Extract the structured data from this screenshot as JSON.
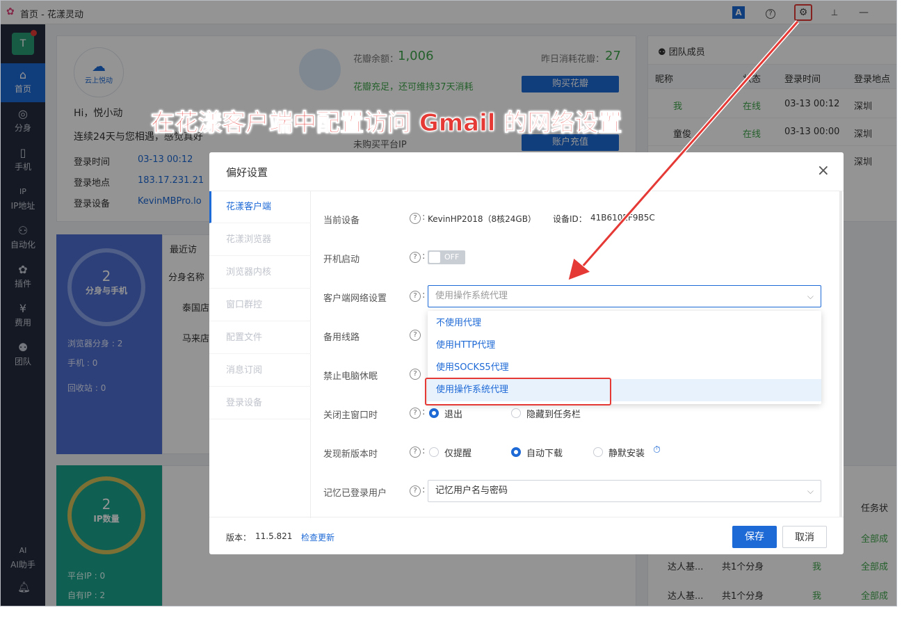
{
  "window": {
    "title": "首页 - 花漾灵动"
  },
  "topbar": {
    "translate_icon": "A",
    "help_icon": "?",
    "settings_icon": "⚙",
    "pin_icon": "📌",
    "minimize": "—"
  },
  "sidebar": {
    "avatar": "T",
    "items": [
      {
        "label": "首页",
        "icon": "⌂"
      },
      {
        "label": "分身",
        "icon": "◎"
      },
      {
        "label": "手机",
        "icon": "▯"
      },
      {
        "label": "IP地址",
        "icon": "IP"
      },
      {
        "label": "自动化",
        "icon": "⚇"
      },
      {
        "label": "插件",
        "icon": "✿"
      },
      {
        "label": "费用",
        "icon": "¥"
      },
      {
        "label": "团队",
        "icon": "⚉"
      },
      {
        "label": "AI助手",
        "icon": "AI"
      }
    ]
  },
  "profile": {
    "logo_text": "云上悦动",
    "greeting": "Hi，悦小动",
    "days": "连续24天与您相遇，感觉真好",
    "login_time_label": "登录时间",
    "login_time": "03-13 00:12",
    "login_place_label": "登录地点",
    "login_place": "183.17.231.21",
    "login_device_label": "登录设备",
    "login_device": "KevinMBPro.lo"
  },
  "petals": {
    "balance_label": "花瓣余额：",
    "balance": "1,006",
    "yesterday_label": "昨日消耗花瓣：",
    "yesterday": "27",
    "status": "花瓣充足，还可维持37天消耗",
    "buy_btn": "购买花瓣",
    "platform_ip": "未购买平台IP",
    "recharge_btn": "账户充值"
  },
  "team": {
    "title": "团队成员",
    "cols": [
      "昵称",
      "状态",
      "登录时间",
      "登录地点"
    ],
    "rows": [
      {
        "name": "我",
        "status": "在线",
        "time": "03-13 00:12",
        "place": "深圳"
      },
      {
        "name": "童俊",
        "status": "在线",
        "time": "03-13 00:00",
        "place": "深圳"
      },
      {
        "name": "",
        "status": "",
        "time": "",
        "place": "深圳"
      }
    ]
  },
  "stats": {
    "ring1_num": "2",
    "ring1_label": "分身与手机",
    "browser_label": "浏览器分身",
    "browser_val": ": 2",
    "phone_label": "手机",
    "phone_val": ": 0",
    "recycle_label": "回收站",
    "recycle_val": ": 0",
    "ring2_num": "2",
    "ring2_label": "IP数量",
    "platform_ip_label": "平台IP",
    "platform_ip_val": ": 0",
    "own_ip_label": "自有IP",
    "own_ip_val": ": 2"
  },
  "recent": {
    "title": "最近访",
    "col": "分身名称",
    "items": [
      "泰国店",
      "马来店"
    ]
  },
  "tasks": {
    "col": "任务状",
    "rows": [
      {
        "name": "达人基...",
        "count": "共1个分身",
        "user": "我",
        "status": "全部成"
      },
      {
        "name": "达人基...",
        "count": "共1个分身",
        "user": "我",
        "status": "全部成"
      },
      {
        "name": "",
        "count": "",
        "user": "",
        "status": "全部成"
      }
    ]
  },
  "annotation": "在花漾客户端中配置访问 Gmail 的网络设置",
  "dialog": {
    "title": "偏好设置",
    "tabs": [
      "花漾客户端",
      "花漾浏览器",
      "浏览器内核",
      "窗口群控",
      "配置文件",
      "消息订阅",
      "登录设备"
    ],
    "device_label": "当前设备",
    "device_value": "KevinHP2018（8核24GB）",
    "device_id_label": "设备ID：",
    "device_id": "41B610EF9B5C",
    "autostart_label": "开机启动",
    "autostart_state": "OFF",
    "network_label": "客户端网络设置",
    "network_value": "使用操作系统代理",
    "backup_label": "备用线路",
    "sleep_label": "禁止电脑休眠",
    "close_label": "关闭主窗口时",
    "close_opt1": "退出",
    "close_opt2": "隐藏到任务栏",
    "update_label": "发现新版本时",
    "update_opt1": "仅提醒",
    "update_opt2": "自动下载",
    "update_opt3": "静默安装",
    "remember_label": "记忆已登录用户",
    "remember_value": "记忆用户名与密码",
    "version_label": "版本：",
    "version": "11.5.821",
    "check_update": "检查更新",
    "save": "保存",
    "cancel": "取消"
  },
  "dropdown": {
    "options": [
      "不使用代理",
      "使用HTTP代理",
      "使用SOCKS5代理",
      "使用操作系统代理"
    ]
  },
  "colors": {
    "primary": "#1d69d6",
    "sidebar": "#252c3d",
    "highlight": "#e53935",
    "green": "#3fa64a"
  }
}
